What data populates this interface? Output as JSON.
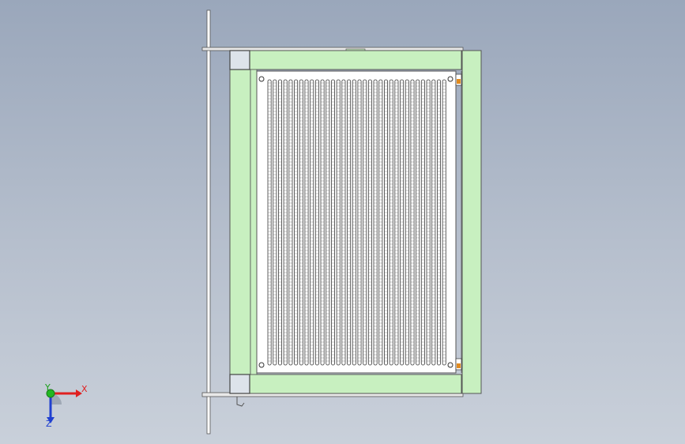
{
  "view": {
    "background_top": "#9aa7bb",
    "background_bottom": "#c9d0da",
    "frame_color": "#c8f0c0",
    "panel_color": "#ffffff",
    "accent_orange": "#e08a20"
  },
  "triad": {
    "x_label": "X",
    "y_label": "Y",
    "z_label": "Z",
    "x_color": "#e02020",
    "y_color": "#1aa01a",
    "z_color": "#2040d0"
  }
}
